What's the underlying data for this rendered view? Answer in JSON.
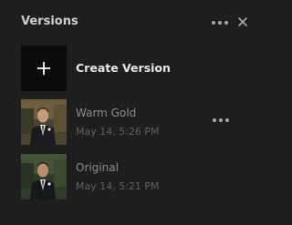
{
  "header": {
    "title": "Versions",
    "more_icon": "more-horizontal-icon",
    "close_icon": "close-icon"
  },
  "create": {
    "icon": "plus-icon",
    "label": "Create Version"
  },
  "versions": [
    {
      "name": "Warm Gold",
      "date": "May 14, 5:26 PM",
      "thumbnail": "portrait-photo-warm",
      "has_more_menu": true
    },
    {
      "name": "Original",
      "date": "May 14, 5:21 PM",
      "thumbnail": "portrait-photo-original",
      "has_more_menu": false
    }
  ],
  "colors": {
    "background": "#1e1e1e",
    "tile": "#0b0b0b",
    "text_primary": "#e6e6e6",
    "text_secondary": "#8c8c8c",
    "text_muted": "#5f5f5f"
  }
}
